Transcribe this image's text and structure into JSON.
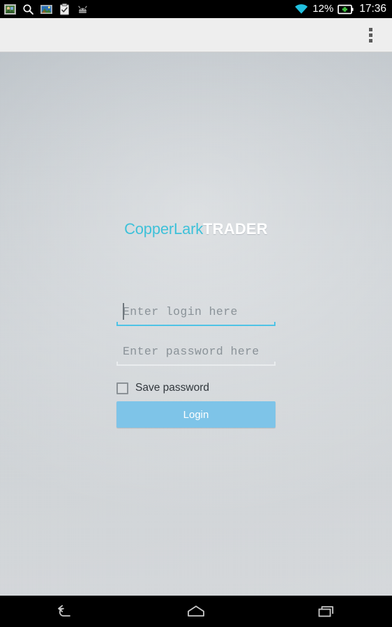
{
  "status_bar": {
    "notifications": [
      {
        "name": "photo-app-icon"
      },
      {
        "name": "search-icon"
      },
      {
        "name": "gallery-icon"
      },
      {
        "name": "clipboard-icon"
      },
      {
        "name": "android-update-icon"
      }
    ],
    "wifi_icon": "wifi-icon",
    "wifi_color": "#21c0df",
    "battery_percent": "12%",
    "battery_icon": "battery-charging-icon",
    "battery_charge_color": "#3ebf3e",
    "clock": "17:36"
  },
  "action_bar": {
    "overflow_label": "More options"
  },
  "login": {
    "brand_primary": "CopperLark",
    "brand_secondary": "TRADER",
    "brand_primary_color": "#3fc1d9",
    "brand_secondary_color": "#ffffff",
    "login_value": "",
    "login_placeholder": "Enter login here",
    "password_value": "",
    "password_placeholder": "Enter password here",
    "save_password_label": "Save password",
    "save_password_checked": false,
    "login_button_label": "Login",
    "login_button_color": "#7ec4e8",
    "focused_underline_color": "#4ec3e6"
  },
  "nav_bar": {
    "back_label": "Back",
    "home_label": "Home",
    "recents_label": "Recent apps"
  }
}
